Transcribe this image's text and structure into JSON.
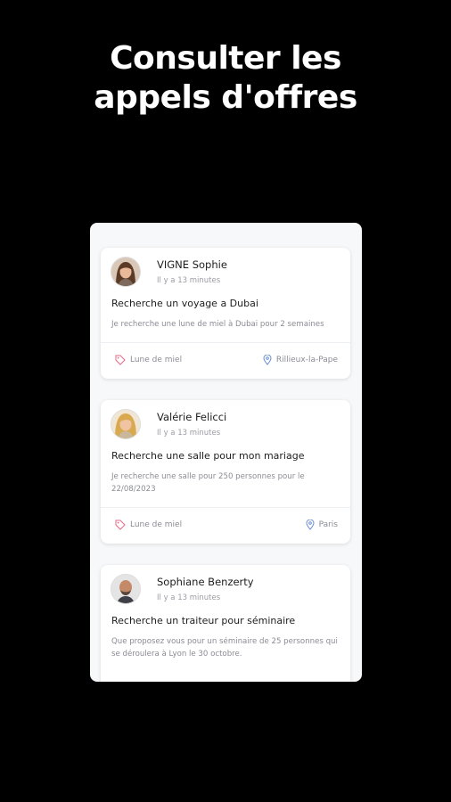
{
  "headline": {
    "line1": "Consulter les",
    "line2": "appels d'offres"
  },
  "cards": [
    {
      "name": "VIGNE Sophie",
      "time": "Il y a 13 minutes",
      "title": "Recherche un voyage a Dubai",
      "description": "Je recherche une lune de miel à Dubai pour 2 semaines",
      "category": "Lune de miel",
      "location": "Rillieux-la-Pape",
      "avatar_icon": "avatar-woman-brown-hair"
    },
    {
      "name": "Valérie Felicci",
      "time": "Il y a 13 minutes",
      "title": "Recherche une salle pour mon mariage",
      "description": "Je recherche une salle pour 250 personnes pour le 22/08/2023",
      "category": "Lune de miel",
      "location": "Paris",
      "avatar_icon": "avatar-woman-blonde-hair"
    },
    {
      "name": "Sophiane Benzerty",
      "time": "Il y a 13 minutes",
      "title": "Recherche un traiteur pour séminaire",
      "description": "Que proposez vous pour un séminaire de 25 personnes qui se déroulera à Lyon le 30 octobre.",
      "avatar_icon": "avatar-man-bald"
    }
  ],
  "colors": {
    "tag_icon": "#e46a86",
    "location_icon": "#6b8fd6",
    "background": "#000000"
  }
}
